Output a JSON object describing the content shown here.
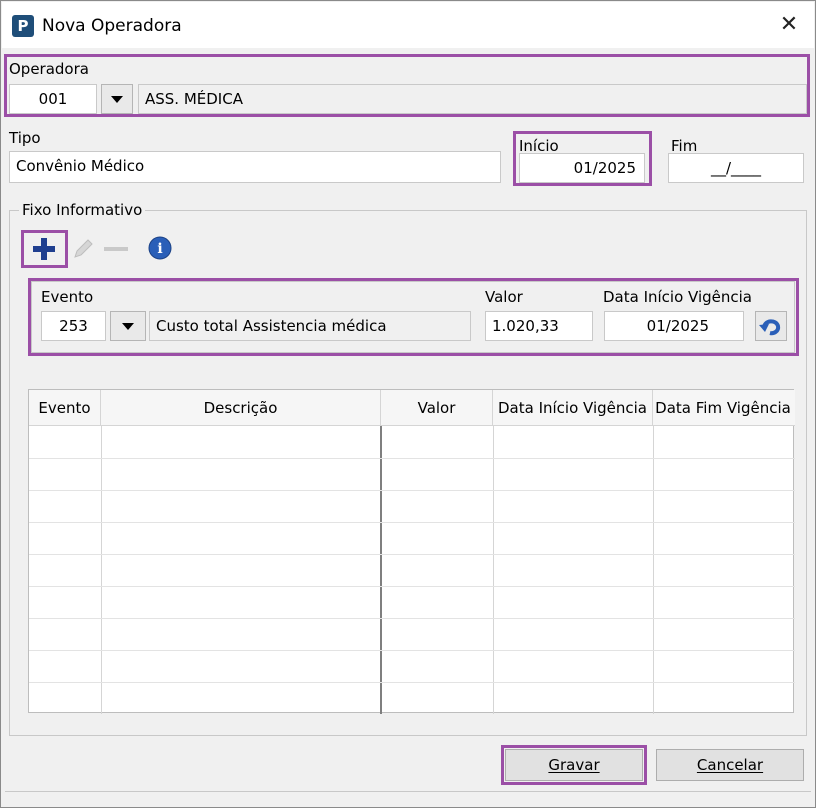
{
  "window": {
    "title": "Nova Operadora",
    "icon_letter": "P",
    "close_glyph": "✕"
  },
  "operadora": {
    "label": "Operadora",
    "code": "001",
    "name": "ASS. MÉDICA"
  },
  "tipo": {
    "label": "Tipo",
    "value": "Convênio Médico"
  },
  "inicio": {
    "label": "Início",
    "value": "01/2025"
  },
  "fim": {
    "label": "Fim",
    "value": "__/____"
  },
  "fixo": {
    "title": "Fixo Informativo",
    "toolbar": {
      "add_icon": "plus-icon",
      "edit_icon": "pencil-icon",
      "remove_icon": "minus-icon",
      "info_icon": "info-icon",
      "info_glyph": "i"
    },
    "form": {
      "evento_label": "Evento",
      "evento_code": "253",
      "evento_desc": "Custo total Assistencia médica",
      "valor_label": "Valor",
      "valor_value": "1.020,33",
      "data_label": "Data Início Vigência",
      "data_value": "01/2025",
      "undo_icon": "undo-icon"
    },
    "table": {
      "headers": [
        "Evento",
        "Descrição",
        "Valor",
        "Data Início Vigência",
        "Data Fim Vigência"
      ],
      "rows": []
    }
  },
  "buttons": {
    "gravar": "Gravar",
    "cancelar": "Cancelar"
  },
  "colors": {
    "highlight": "#9b4fa6",
    "add_icon": "#1f3f8f",
    "info_icon": "#2a5fb8",
    "app_icon": "#1f4e79"
  }
}
